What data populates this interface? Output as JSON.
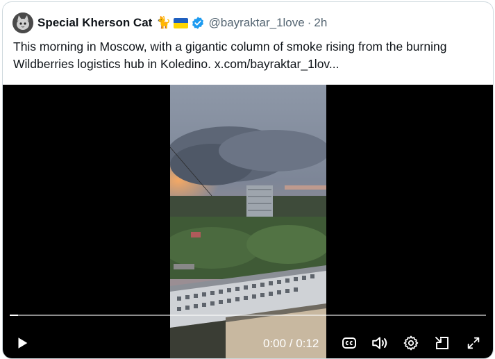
{
  "tweet": {
    "author_name": "Special Kherson Cat",
    "emoji": "🐈",
    "handle": "@bayraktar_1love",
    "separator": "·",
    "time": "2h",
    "text": "This morning in Moscow, with a gigantic column of smoke rising from the burning Wildberries logistics hub in Koledino.  x.com/bayraktar_1lov..."
  },
  "video": {
    "current_time": "0:00",
    "duration": "0:12",
    "time_readout": "0:00 / 0:12",
    "progress_fraction": 0.0
  },
  "icons": {
    "verified": "verified-badge-icon",
    "play": "play-icon",
    "captions": "captions-icon",
    "volume": "volume-icon",
    "settings": "gear-icon",
    "pip": "picture-in-picture-icon",
    "fullscreen": "fullscreen-icon"
  },
  "colors": {
    "verified_blue": "#1d9bf0",
    "text": "#0f1419",
    "muted": "#536471",
    "border": "#cfd9de"
  }
}
